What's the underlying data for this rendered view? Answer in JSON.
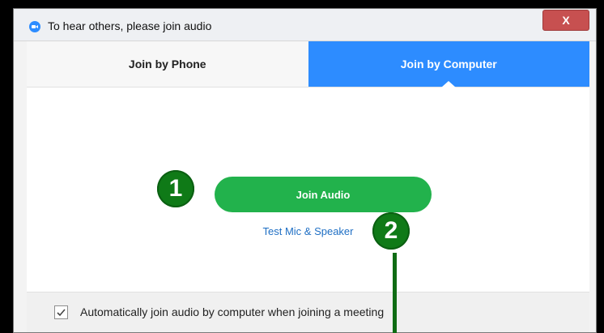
{
  "window": {
    "title": "To hear others, please join audio",
    "close_label": "X",
    "app_icon": "camera-icon"
  },
  "tabs": [
    {
      "label": "Join by Phone",
      "active": false
    },
    {
      "label": "Join by Computer",
      "active": true
    }
  ],
  "main": {
    "join_audio_label": "Join Audio",
    "test_mic_label": "Test Mic & Speaker"
  },
  "footer": {
    "checkbox_checked": true,
    "checkbox_label": "Automatically join audio by computer when joining a meeting"
  },
  "annotations": {
    "callout_1": "1",
    "callout_2": "2"
  },
  "colors": {
    "accent_blue": "#2d8cff",
    "join_green": "#22b24c",
    "callout_green": "#0f7a17"
  }
}
